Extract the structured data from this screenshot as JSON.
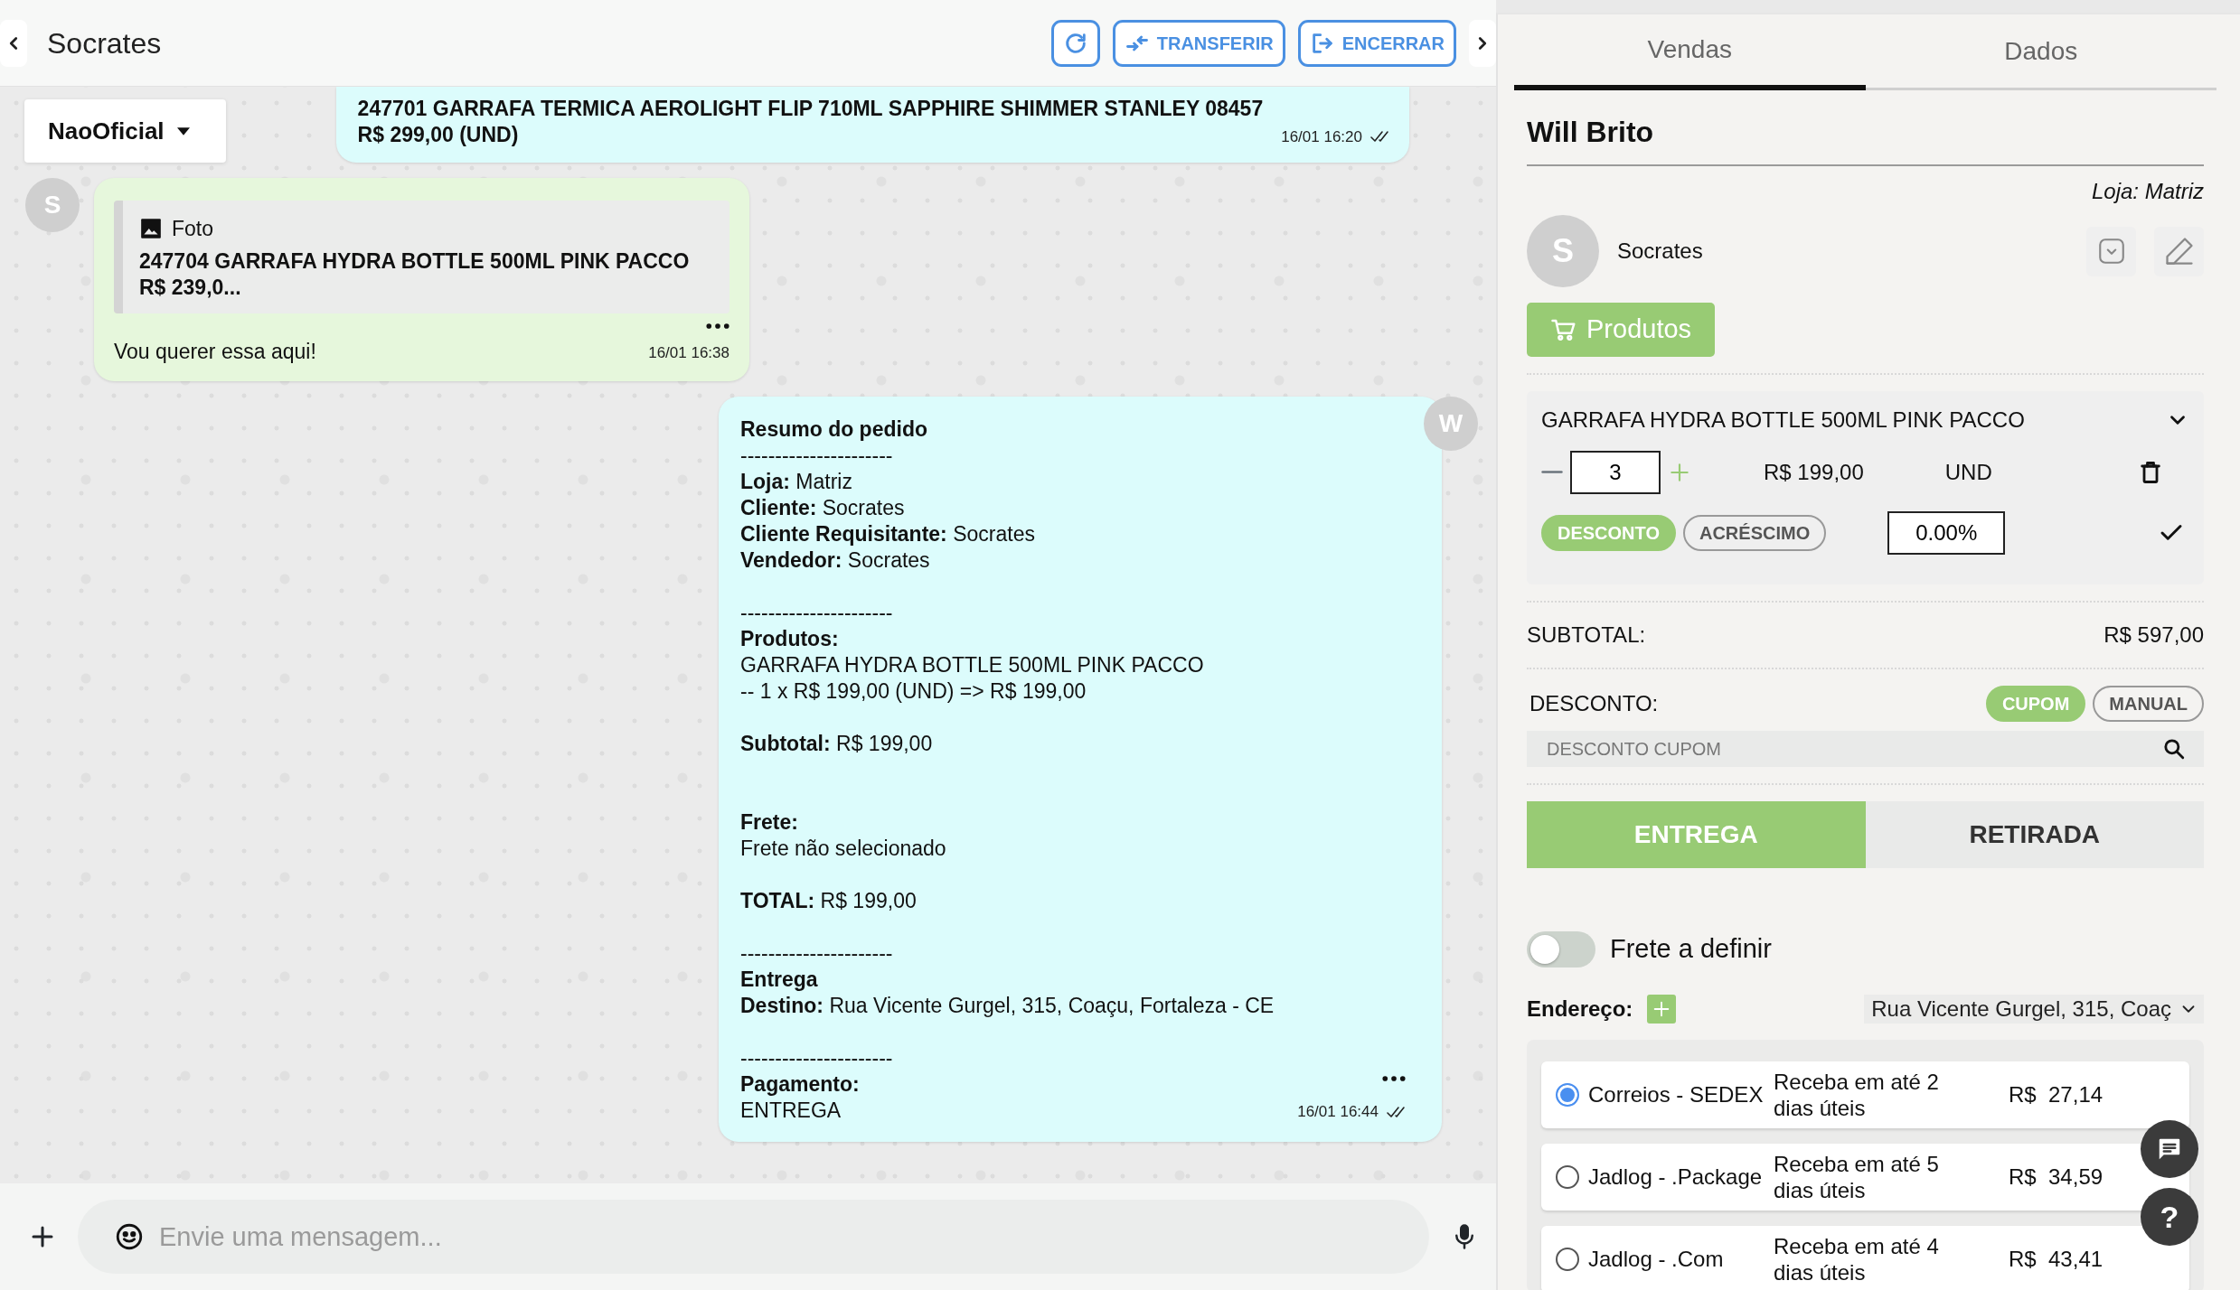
{
  "header": {
    "title": "Socrates",
    "buttons": [
      {
        "kind": "refresh"
      },
      {
        "kind": "transfer",
        "label": "TRANSFERIR"
      },
      {
        "kind": "end",
        "label": "ENCERRAR"
      }
    ]
  },
  "channel_select": {
    "label": "NaoOficial"
  },
  "messages": [
    {
      "kind": "outgoing",
      "bold": true,
      "text": "247701 GARRAFA TERMICA AEROLIGHT FLIP 710ML SAPPHIRE SHIMMER STANLEY 08457\nR$ 299,00 (UND)",
      "time": "16/01 16:20"
    },
    {
      "kind": "incoming",
      "avatar": "S",
      "bold": false,
      "quote": {
        "label": "Foto",
        "text": "247704 GARRAFA HYDRA BOTTLE 500ML PINK PACCO\nR$ 239,0..."
      },
      "text": "Vou querer essa aqui!",
      "time": "16/01 16:38"
    },
    {
      "kind": "outgoing",
      "avatar": "W",
      "bold": false,
      "text": "**Resumo do pedido**\n----------------------\n**Loja:** Matriz\n**Cliente:** Socrates\n**Cliente Requisitante:** Socrates\n**Vendedor:** Socrates\n\n----------------------\n**Produtos:**\nGARRAFA HYDRA BOTTLE 500ML PINK PACCO\n-- 1 x R$ 199,00 (UND) => R$ 199,00\n\n**Subtotal:** R$ 199,00\n\n\n**Frete:**\nFrete não selecionado\n\n**TOTAL:** R$ 199,00\n\n----------------------\n**Entrega**\n**Destino:** Rua Vicente Gurgel, 315, Coaçu, Fortaleza - CE\n\n----------------------\n**Pagamento:**\nENTREGA",
      "time": "16/01 16:44"
    }
  ],
  "composer": {
    "placeholder": "Envie uma mensagem..."
  },
  "tabs": [
    {
      "label": "Vendas",
      "selected": true
    },
    {
      "label": "Dados",
      "selected": false
    }
  ],
  "customer": {
    "name": "Will Brito",
    "store": "Loja: Matriz",
    "contact_avatar": "S",
    "contact_name": "Socrates"
  },
  "products_button": "Produtos",
  "cart_items": [
    {
      "name": "GARRAFA HYDRA BOTTLE 500ML PINK PACCO",
      "quantity": "3",
      "price": "R$ 199,00",
      "unit": "UND",
      "adjustments": [
        {
          "label": "DESCONTO",
          "selected": true
        },
        {
          "label": "ACRÉSCIMO",
          "selected": false
        }
      ],
      "adjustment_value": "0.00%"
    }
  ],
  "subtotal": {
    "label": "SUBTOTAL:",
    "value": "R$ 597,00"
  },
  "discount": {
    "label": "DESCONTO:",
    "modes": [
      {
        "label": "CUPOM",
        "selected": true
      },
      {
        "label": "MANUAL",
        "selected": false
      }
    ],
    "placeholder": "DESCONTO CUPOM"
  },
  "delivery_modes": [
    {
      "label": "ENTREGA",
      "selected": true
    },
    {
      "label": "RETIRADA",
      "selected": false
    }
  ],
  "freight_toggle": {
    "label": "Frete a definir",
    "on": false
  },
  "address": {
    "label": "Endereço:",
    "value": "Rua Vicente Gurgel, 315, Coaç"
  },
  "shipping_options": [
    {
      "carrier": "Correios - SEDEX",
      "eta": "Receba em até 2 dias úteis",
      "price": "R$  27,14",
      "selected": true
    },
    {
      "carrier": "Jadlog - .Package",
      "eta": "Receba em até 5 dias úteis",
      "price": "R$  34,59",
      "selected": false
    },
    {
      "carrier": "Jadlog - .Com",
      "eta": "Receba em até 4 dias úteis",
      "price": "R$  43,41",
      "selected": false
    }
  ],
  "help_button": "?"
}
